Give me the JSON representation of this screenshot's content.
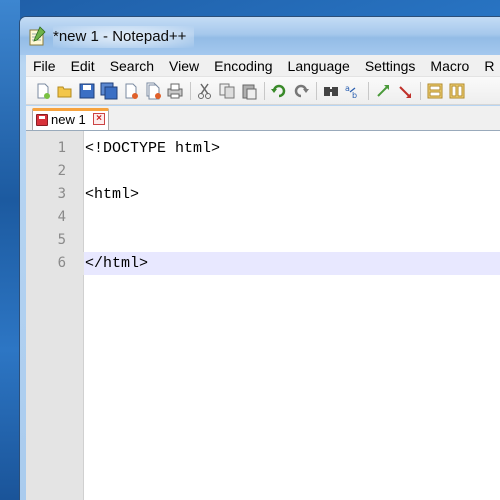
{
  "window": {
    "title": "*new  1 - Notepad++"
  },
  "menu": [
    {
      "label": "File"
    },
    {
      "label": "Edit"
    },
    {
      "label": "Search"
    },
    {
      "label": "View"
    },
    {
      "label": "Encoding"
    },
    {
      "label": "Language"
    },
    {
      "label": "Settings"
    },
    {
      "label": "Macro"
    },
    {
      "label": "R"
    }
  ],
  "toolbar": [
    "new-file-icon",
    "open-file-icon",
    "save-icon",
    "save-all-icon",
    "close-icon",
    "close-all-icon",
    "print-icon",
    "cut-icon",
    "copy-icon",
    "paste-icon",
    "undo-icon",
    "redo-icon",
    "find-icon",
    "replace-icon",
    "zoom-in-icon",
    "zoom-out-icon",
    "sync-vertical-icon",
    "sync-horizontal-icon"
  ],
  "tabs": [
    {
      "label": "new 1",
      "modified": true
    }
  ],
  "editor": {
    "lines": [
      {
        "num": "1",
        "code": "<!DOCTYPE html>"
      },
      {
        "num": "2",
        "code": ""
      },
      {
        "num": "3",
        "code": "<html>"
      },
      {
        "num": "4",
        "code": ""
      },
      {
        "num": "5",
        "code": ""
      },
      {
        "num": "6",
        "code": "</html>"
      }
    ],
    "current_line": 6
  },
  "colors": {
    "tab_accent": "#f7a33e",
    "current_line_bg": "#e8e8ff",
    "gutter_bg": "#e4e4e4",
    "line_number": "#8a8a8a"
  }
}
